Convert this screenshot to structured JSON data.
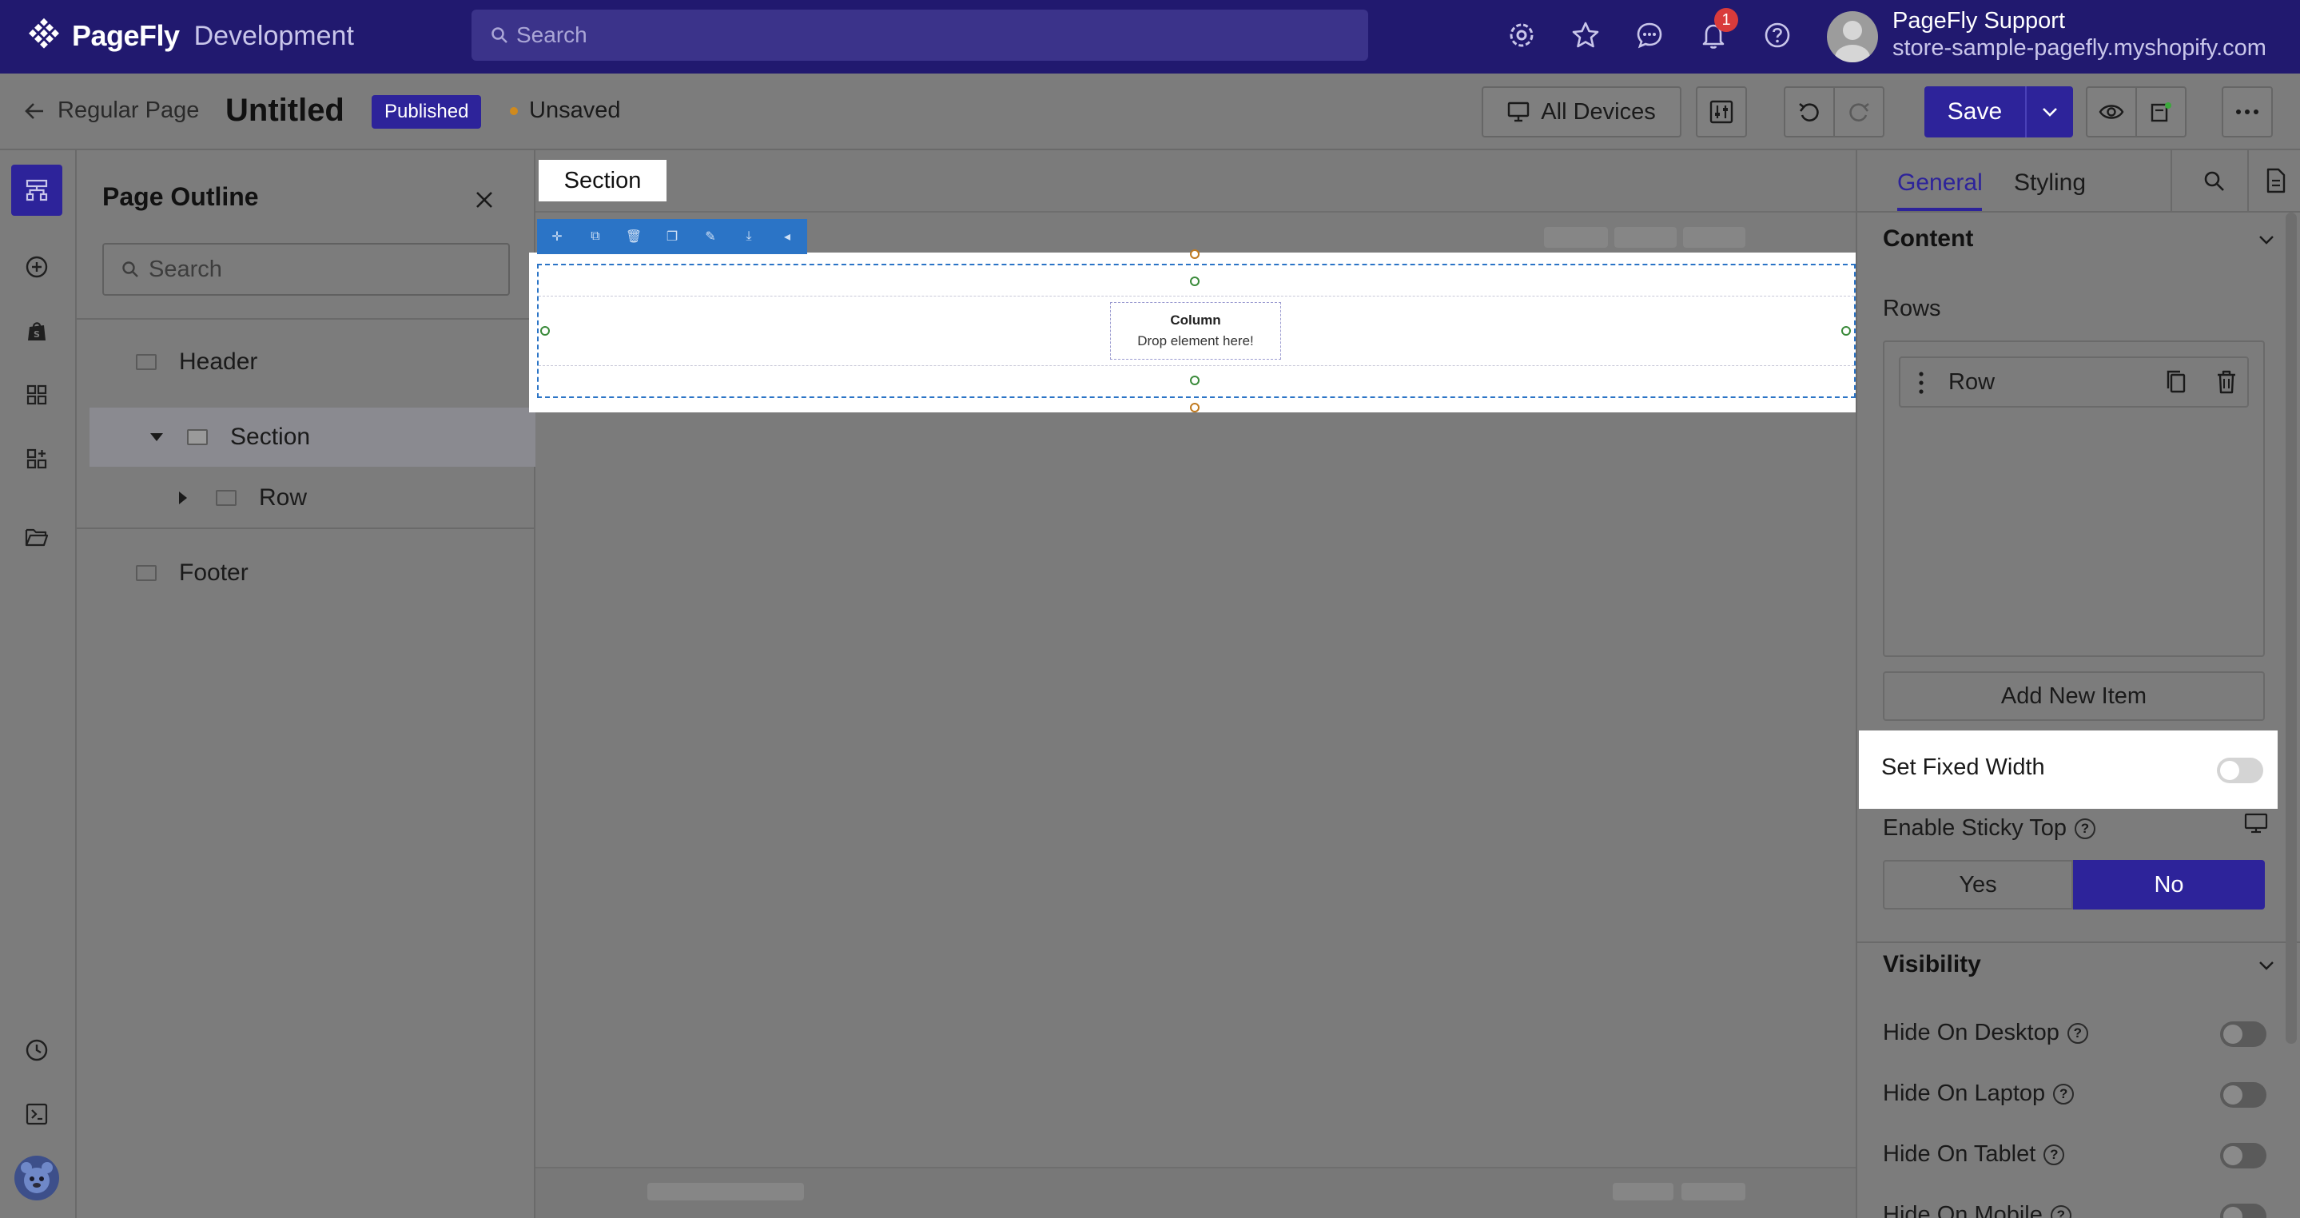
{
  "topbar": {
    "brand": "PageFly",
    "brand_sub": "Development",
    "search_placeholder": "Search",
    "notification_count": "1",
    "user_name": "PageFly Support",
    "user_store": "store-sample-pagefly.myshopify.com"
  },
  "subbar": {
    "back_label": "Regular Page",
    "title": "Untitled",
    "status_badge": "Published",
    "save_state": "Unsaved",
    "devices_label": "All Devices",
    "save_label": "Save"
  },
  "outline": {
    "title": "Page Outline",
    "search_placeholder": "Search",
    "items": [
      {
        "label": "Header"
      },
      {
        "label": "Section"
      },
      {
        "label": "Row"
      },
      {
        "label": "Footer"
      }
    ]
  },
  "canvas": {
    "selected_label": "Section",
    "column_title": "Column",
    "column_hint": "Drop element here!"
  },
  "panel": {
    "tabs": [
      "General",
      "Styling"
    ],
    "content_header": "Content",
    "rows_label": "Rows",
    "row_item": "Row",
    "add_item": "Add New Item",
    "fixed_width": "Set Fixed Width",
    "sticky_top": "Enable Sticky Top",
    "yes": "Yes",
    "no": "No",
    "visibility_header": "Visibility",
    "hide_desktop": "Hide On Desktop",
    "hide_laptop": "Hide On Laptop",
    "hide_tablet": "Hide On Tablet",
    "hide_mobile": "Hide On Mobile"
  },
  "colors": {
    "brand": "#21196f",
    "accent": "#2d239a",
    "selection": "#2b74c6"
  }
}
